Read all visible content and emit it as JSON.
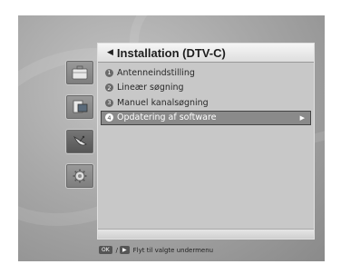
{
  "panel": {
    "back_glyph": "◀",
    "title": "Installation (DTV-C)"
  },
  "menu_items": [
    {
      "number": "1",
      "label": "Antenneindstilling"
    },
    {
      "number": "2",
      "label": "Lineær søgning"
    },
    {
      "number": "3",
      "label": "Manuel kanalsøgning"
    },
    {
      "number": "4",
      "label": "Opdatering af software",
      "selected": true
    }
  ],
  "selected_arrow": "▶",
  "sidebar": {
    "icons": [
      "suitcase-icon",
      "tv-guide-icon",
      "satellite-dish-icon",
      "gear-icon"
    ],
    "selected_index": 2
  },
  "help": {
    "ok_key": "OK",
    "separator": "/",
    "right_key": "▶",
    "text": "Flyt til valgte undermenu"
  }
}
